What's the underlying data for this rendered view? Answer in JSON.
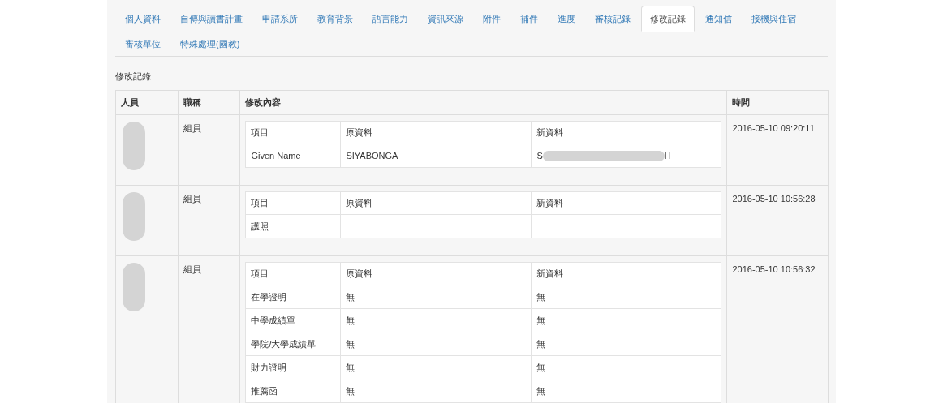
{
  "tabs": [
    {
      "label": "個人資料",
      "selected": false
    },
    {
      "label": "自傳與讀書計畫",
      "selected": false
    },
    {
      "label": "申請系所",
      "selected": false
    },
    {
      "label": "教育背景",
      "selected": false
    },
    {
      "label": "語言能力",
      "selected": false
    },
    {
      "label": "資訊來源",
      "selected": false
    },
    {
      "label": "附件",
      "selected": false
    },
    {
      "label": "補件",
      "selected": false
    },
    {
      "label": "進度",
      "selected": false
    },
    {
      "label": "審核記錄",
      "selected": false
    },
    {
      "label": "修改記錄",
      "selected": true
    },
    {
      "label": "通知信",
      "selected": false
    },
    {
      "label": "接機與住宿",
      "selected": false
    },
    {
      "label": "審核單位",
      "selected": false
    },
    {
      "label": "特殊處理(國教)",
      "selected": false
    }
  ],
  "section_title": "修改記錄",
  "table": {
    "columns": [
      "人員",
      "職稱",
      "修改內容",
      "時間"
    ],
    "rows": [
      {
        "title": "組員",
        "time": "2016-05-10 09:20:11",
        "changes": {
          "columns": [
            "項目",
            "原資料",
            "新資料"
          ],
          "rows": [
            {
              "item": "Given Name",
              "old": "SIYABONGA",
              "old_struck": true,
              "new": [
                "S",
                "H"
              ]
            }
          ]
        }
      },
      {
        "title": "組員",
        "time": "2016-05-10 10:56:28",
        "changes": {
          "columns": [
            "項目",
            "原資料",
            "新資料"
          ],
          "rows": [
            {
              "item": "護照"
            }
          ]
        }
      },
      {
        "title": "組員",
        "time": "2016-05-10 10:56:32",
        "changes": {
          "columns": [
            "項目",
            "原資料",
            "新資料"
          ],
          "rows": [
            {
              "item": "在學證明",
              "old": "無",
              "old_struck": false,
              "new": [
                "無"
              ]
            },
            {
              "item": "中學成績單",
              "old": "無",
              "old_struck": false,
              "new": [
                "無"
              ]
            },
            {
              "item": "學院/大學成績單",
              "old": "無",
              "old_struck": false,
              "new": [
                "無"
              ]
            },
            {
              "item": "財力證明",
              "old": "無",
              "old_struck": false,
              "new": [
                "無"
              ]
            },
            {
              "item": "推薦函",
              "old": "無",
              "old_struck": false,
              "new": [
                "無"
              ]
            },
            {}
          ]
        }
      }
    ]
  }
}
